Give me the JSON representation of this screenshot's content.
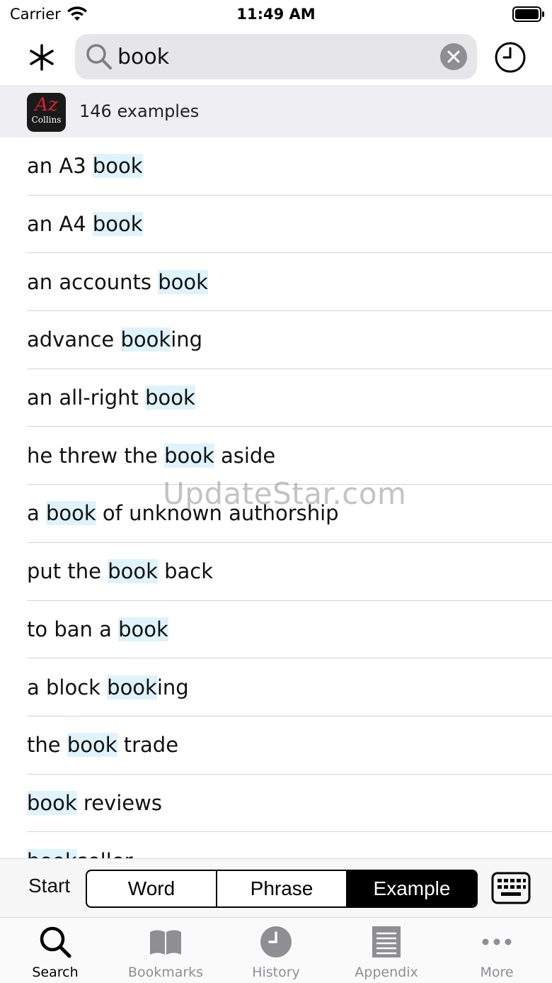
{
  "status_bar": {
    "carrier": "Carrier",
    "time": "11:49 AM"
  },
  "header": {
    "search_value": "book",
    "icons": {
      "wildcard": "asterisk-icon",
      "search": "search-icon",
      "clear": "clear-icon",
      "history": "clock-icon"
    }
  },
  "banner": {
    "logo_az": "Az",
    "logo_name": "Collins",
    "count_text": "146 examples"
  },
  "results": [
    {
      "before": "an A3 ",
      "match": "book",
      "after": ""
    },
    {
      "before": "an A4 ",
      "match": "book",
      "after": ""
    },
    {
      "before": "an accounts ",
      "match": "book",
      "after": ""
    },
    {
      "before": "advance ",
      "match": "book",
      "after": "ing"
    },
    {
      "before": "an all-right ",
      "match": "book",
      "after": ""
    },
    {
      "before": "he threw the ",
      "match": "book",
      "after": " aside"
    },
    {
      "before": "a ",
      "match": "book",
      "after": " of unknown authorship"
    },
    {
      "before": "put the ",
      "match": "book",
      "after": " back"
    },
    {
      "before": "to ban a ",
      "match": "book",
      "after": ""
    },
    {
      "before": "a block ",
      "match": "book",
      "after": "ing"
    },
    {
      "before": "the ",
      "match": "book",
      "after": " trade"
    },
    {
      "before": "",
      "match": "book",
      "after": " reviews"
    },
    {
      "before": "",
      "match": "book",
      "after": "seller"
    }
  ],
  "watermark": "UpdateStar.com",
  "mode_bar": {
    "start_label": "Start",
    "segments": [
      "Word",
      "Phrase",
      "Example"
    ],
    "selected": "Example"
  },
  "tab_bar": {
    "tabs": [
      {
        "label": "Search",
        "icon": "search-icon",
        "active": true
      },
      {
        "label": "Bookmarks",
        "icon": "book-icon",
        "active": false
      },
      {
        "label": "History",
        "icon": "clock-icon",
        "active": false
      },
      {
        "label": "Appendix",
        "icon": "document-icon",
        "active": false
      },
      {
        "label": "More",
        "icon": "more-icon",
        "active": false
      }
    ]
  },
  "colors": {
    "highlight": "#dff3fc",
    "banner_bg": "#efeff3",
    "search_bg": "#e6e6ea",
    "tab_inactive": "#8e8e93"
  }
}
